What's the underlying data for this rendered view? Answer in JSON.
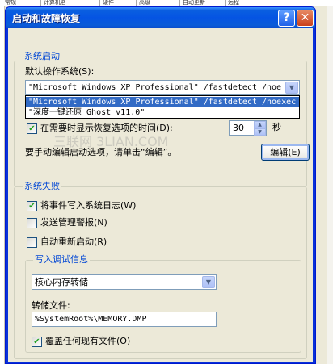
{
  "background_tabs": [
    "常规",
    "计算机名",
    "硬件",
    "高级",
    "自动更新",
    "远程"
  ],
  "window": {
    "title": "启动和故障恢复",
    "help_glyph": "?",
    "close_glyph": "✕"
  },
  "system_startup": {
    "group_label": "系统启动",
    "default_os_label": "默认操作系统(S):",
    "default_os_value": "\"Microsoft Windows XP Professional\" /fastdetect /noe",
    "dropdown_options": [
      "\"Microsoft Windows XP Professional\" /fastdetect /noexec",
      "\"深度一键还原 Ghost v11.0\""
    ],
    "show_recovery_label": "在需要时显示恢复选项的时间(D):",
    "show_recovery_checked": true,
    "seconds_value": "30",
    "seconds_unit": "秒",
    "edit_hint": "要手动编辑启动选项，请单击“编辑”。",
    "edit_button": "编辑(E)"
  },
  "system_failure": {
    "group_label": "系统失败",
    "write_event_label": "将事件写入系统日志(W)",
    "write_event_checked": true,
    "send_alert_label": "发送管理警报(N)",
    "send_alert_checked": false,
    "auto_restart_label": "自动重新启动(R)",
    "auto_restart_checked": false,
    "debug": {
      "group_label": "写入调试信息",
      "dump_type_value": "核心内存转储",
      "dump_file_label": "转储文件:",
      "dump_file_value": "%SystemRoot%\\MEMORY.DMP",
      "overwrite_label": "覆盖任何现有文件(O)",
      "overwrite_checked": true
    }
  },
  "watermark": "三联网 3LIAN.COM"
}
